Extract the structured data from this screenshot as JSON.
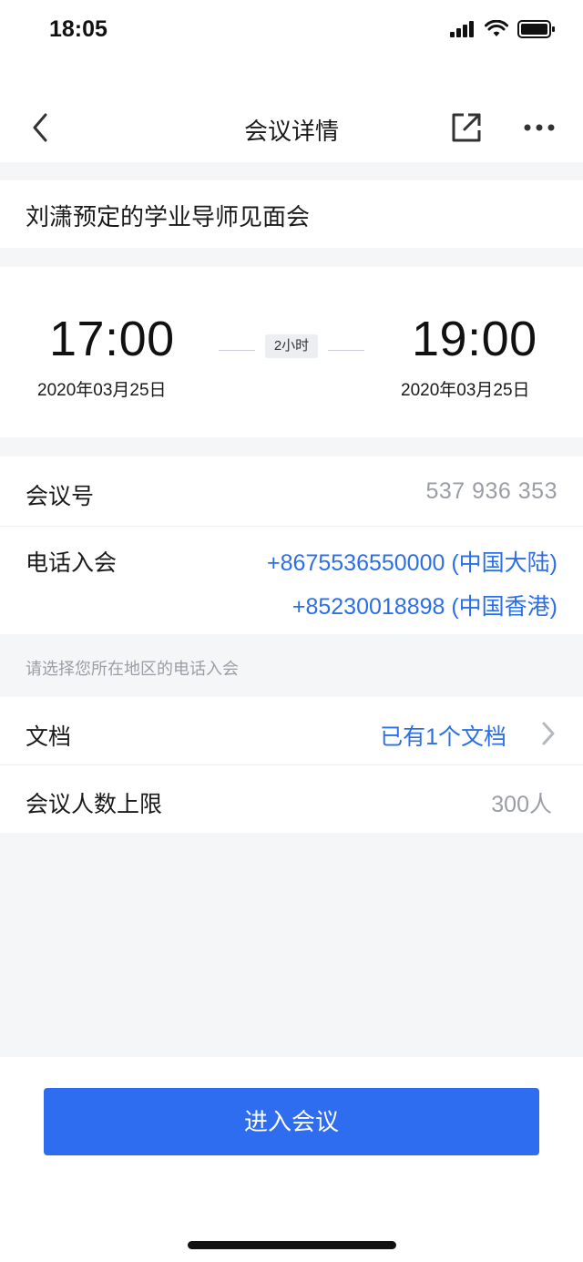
{
  "status_bar": {
    "time": "18:05"
  },
  "nav": {
    "title": "会议详情"
  },
  "meeting": {
    "subject": "刘潇预定的学业导师见面会",
    "start_time": "17:00",
    "start_date": "2020年03月25日",
    "end_time": "19:00",
    "end_date": "2020年03月25日",
    "duration": "2小时"
  },
  "info": {
    "meeting_id_label": "会议号",
    "meeting_id_value": "537 936 353",
    "phone_label": "电话入会",
    "phone_numbers": [
      "+8675536550000 (中国大陆)",
      "+85230018898 (中国香港)"
    ],
    "phone_hint": "请选择您所在地区的电话入会"
  },
  "docs": {
    "label": "文档",
    "value": "已有1个文档"
  },
  "limit": {
    "label": "会议人数上限",
    "value": "300人"
  },
  "actions": {
    "join_label": "进入会议"
  },
  "colors": {
    "accent": "#2e6cf0",
    "link": "#2b6fe8",
    "muted": "#9a9ea4",
    "background": "#f5f6f8"
  },
  "icons": {
    "back": "chevron-left-icon",
    "share": "share-external-icon",
    "more": "more-dots-icon",
    "doc_arrow": "chevron-right-icon",
    "signal": "signal-icon",
    "wifi": "wifi-icon",
    "battery": "battery-icon"
  }
}
